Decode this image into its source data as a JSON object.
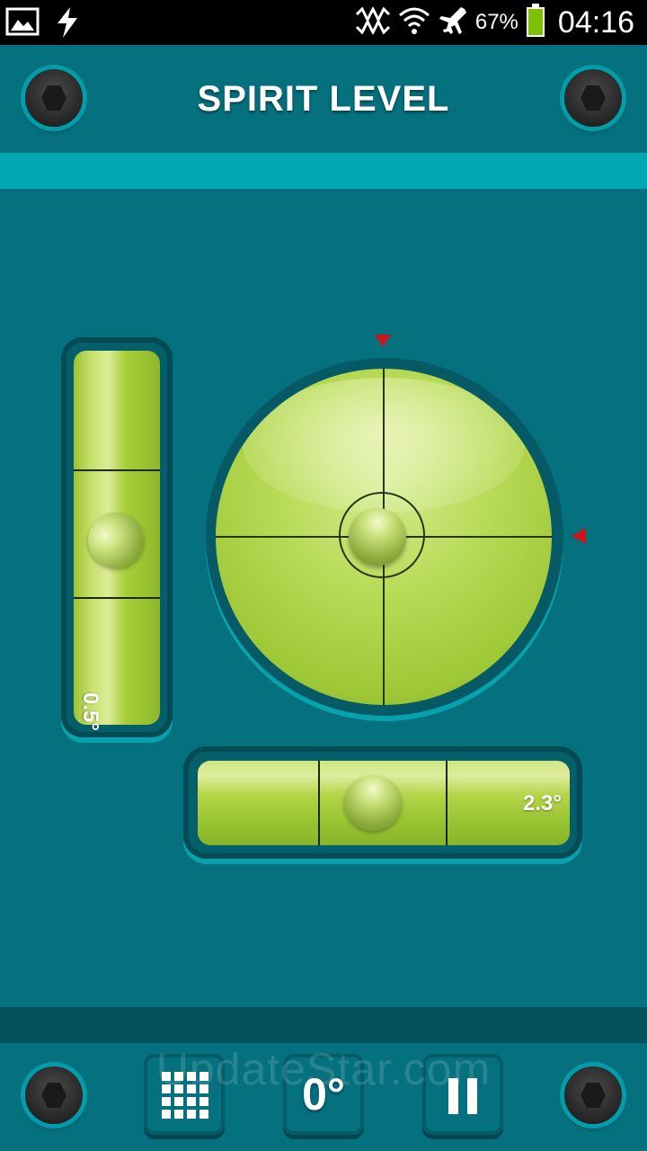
{
  "status_bar": {
    "battery_percent": "67%",
    "clock": "04:16",
    "icons": [
      "gallery-icon",
      "usb-icon",
      "mute-icon",
      "wifi-icon",
      "airplane-icon",
      "battery-icon"
    ]
  },
  "header": {
    "title": "SPIRIT LEVEL"
  },
  "levels": {
    "vertical": {
      "angle_label": "0.5°"
    },
    "horizontal": {
      "angle_label": "2.3°"
    }
  },
  "toolbar": {
    "calibrate_label": "0°",
    "icons": [
      "grid-icon",
      "calibrate-icon",
      "pause-icon"
    ]
  },
  "watermark": "UpdateStar.com",
  "colors": {
    "background": "#05707E",
    "accent_stripe": "#03A7B4",
    "level_green": "#9EC836",
    "marker_red": "#C8161C"
  }
}
